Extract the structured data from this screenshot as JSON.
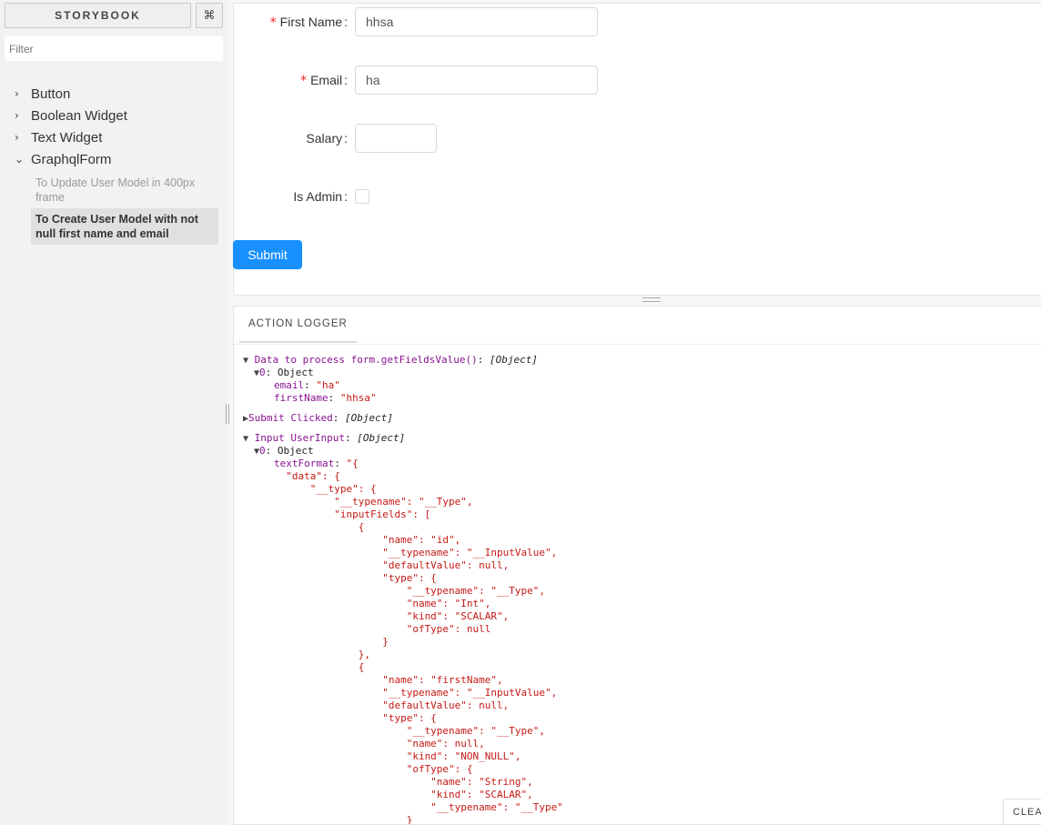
{
  "sidebar": {
    "brand": "STORYBOOK",
    "shortcut_icon": "⌘",
    "filter_placeholder": "Filter",
    "tree": [
      {
        "label": "Button",
        "expanded": false
      },
      {
        "label": "Boolean Widget",
        "expanded": false
      },
      {
        "label": "Text Widget",
        "expanded": false
      },
      {
        "label": "GraphqlForm",
        "expanded": true
      }
    ],
    "stories": [
      {
        "label": "To Update User Model in 400px frame",
        "active": false
      },
      {
        "label": "To Create User Model with not null first name and email",
        "active": true
      }
    ]
  },
  "form": {
    "first_name": {
      "label": "First Name",
      "value": "hhsa",
      "required": true
    },
    "email": {
      "label": "Email",
      "value": "ha",
      "required": true
    },
    "salary": {
      "label": "Salary",
      "value": ""
    },
    "is_admin": {
      "label": "Is Admin",
      "checked": false
    },
    "submit_label": "Submit"
  },
  "panel": {
    "tab": "ACTION LOGGER",
    "clear_label": "CLEAR"
  },
  "log": {
    "a1_title": "Data to process form.getFieldsValue()",
    "a1_type": "[Object]",
    "a1_idx": "0",
    "a1_obj": "Object",
    "a1_email_key": "email",
    "a1_email_val": "\"ha\"",
    "a1_fn_key": "firstName",
    "a1_fn_val": "\"hhsa\"",
    "a2_title": "Submit Clicked",
    "a2_type": "[Object]",
    "a3_title": "Input UserInput",
    "a3_type": "[Object]",
    "a3_idx": "0",
    "a3_obj": "Object",
    "a3_tf_key": "textFormat",
    "json_lines": [
      "\"{",
      "  \"data\": {",
      "      \"__type\": {",
      "          \"__typename\": \"__Type\",",
      "          \"inputFields\": [",
      "              {",
      "                  \"name\": \"id\",",
      "                  \"__typename\": \"__InputValue\",",
      "                  \"defaultValue\": null,",
      "                  \"type\": {",
      "                      \"__typename\": \"__Type\",",
      "                      \"name\": \"Int\",",
      "                      \"kind\": \"SCALAR\",",
      "                      \"ofType\": null",
      "                  }",
      "              },",
      "              {",
      "                  \"name\": \"firstName\",",
      "                  \"__typename\": \"__InputValue\",",
      "                  \"defaultValue\": null,",
      "                  \"type\": {",
      "                      \"__typename\": \"__Type\",",
      "                      \"name\": null,",
      "                      \"kind\": \"NON_NULL\",",
      "                      \"ofType\": {",
      "                          \"name\": \"String\",",
      "                          \"kind\": \"SCALAR\",",
      "                          \"__typename\": \"__Type\"",
      "                      }"
    ]
  },
  "colors": {
    "primary": "#1890ff",
    "required": "#f5222d",
    "log_key": "#881391",
    "log_string": "#c41a16"
  }
}
